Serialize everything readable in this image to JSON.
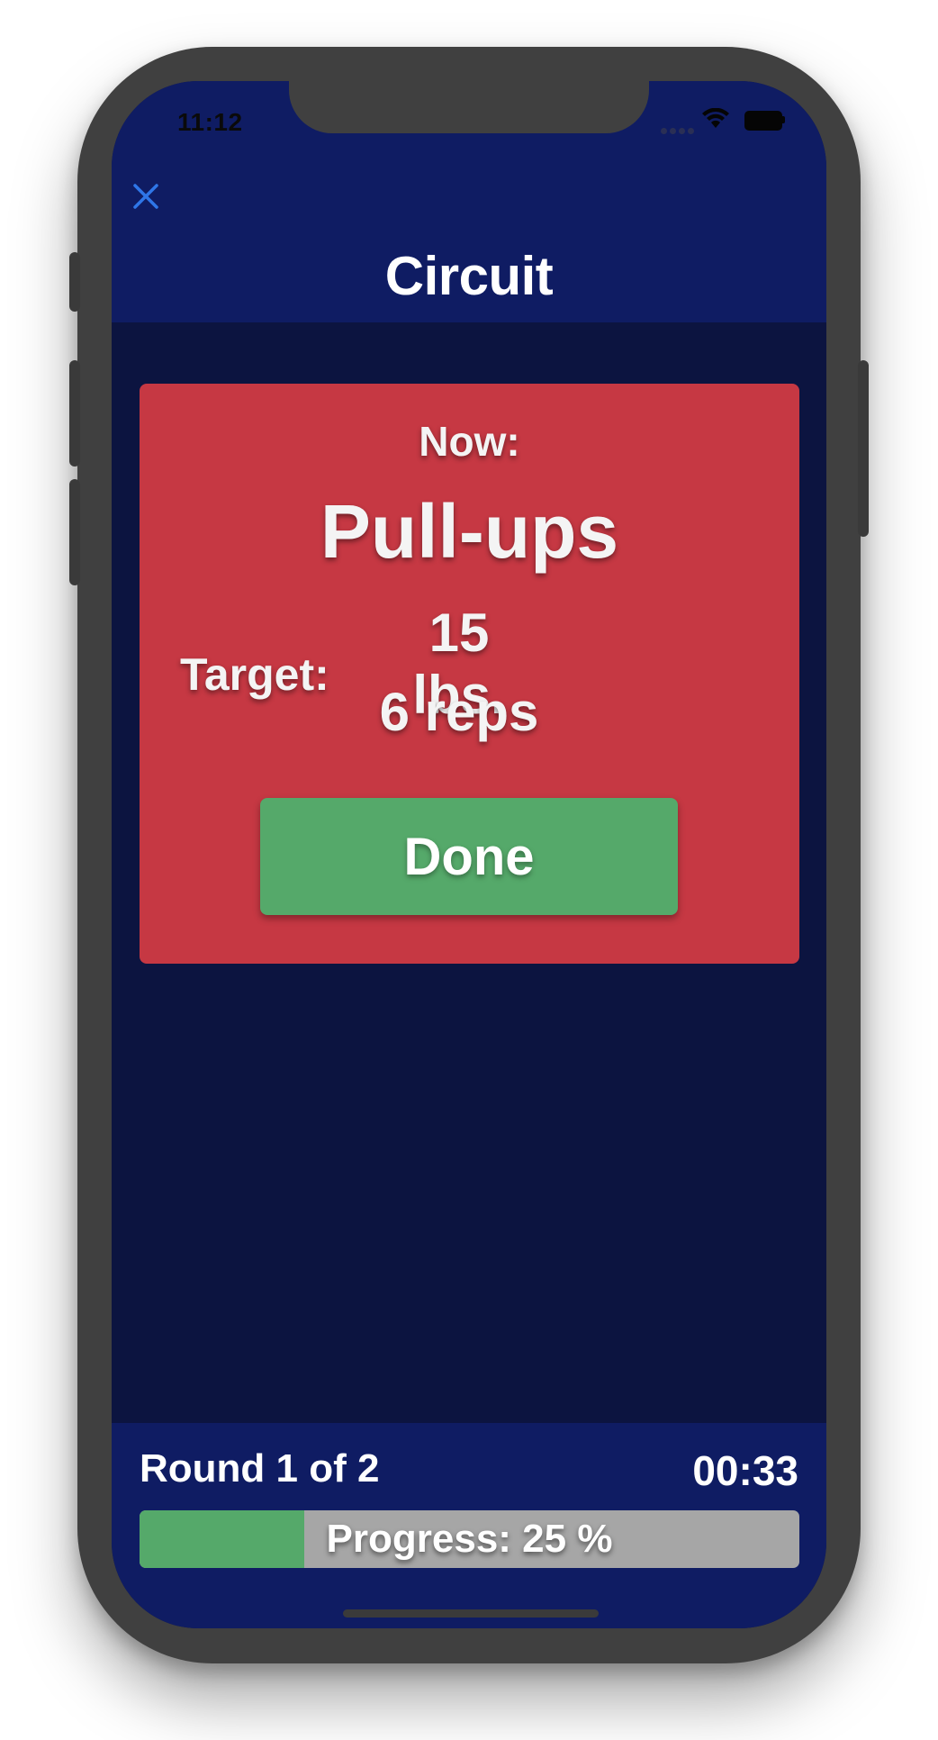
{
  "status_bar": {
    "time": "11:12"
  },
  "header": {
    "close_icon": "close-icon",
    "title": "Circuit"
  },
  "card": {
    "now_label": "Now:",
    "exercise": "Pull-ups",
    "target_label": "Target:",
    "weight": "15 lbs.",
    "reps": "6 reps",
    "done_label": "Done"
  },
  "footer": {
    "round": "Round 1 of 2",
    "timer": "00:33",
    "progress_text": "Progress: 25 %",
    "progress_fraction": 0.25
  },
  "colors": {
    "header_bg": "#0f1c63",
    "content_bg": "#0c1440",
    "card_bg": "#c63843",
    "button_bg": "#55a96a",
    "progress_track": "#a6a6a6",
    "close_icon": "#2f76e8"
  }
}
